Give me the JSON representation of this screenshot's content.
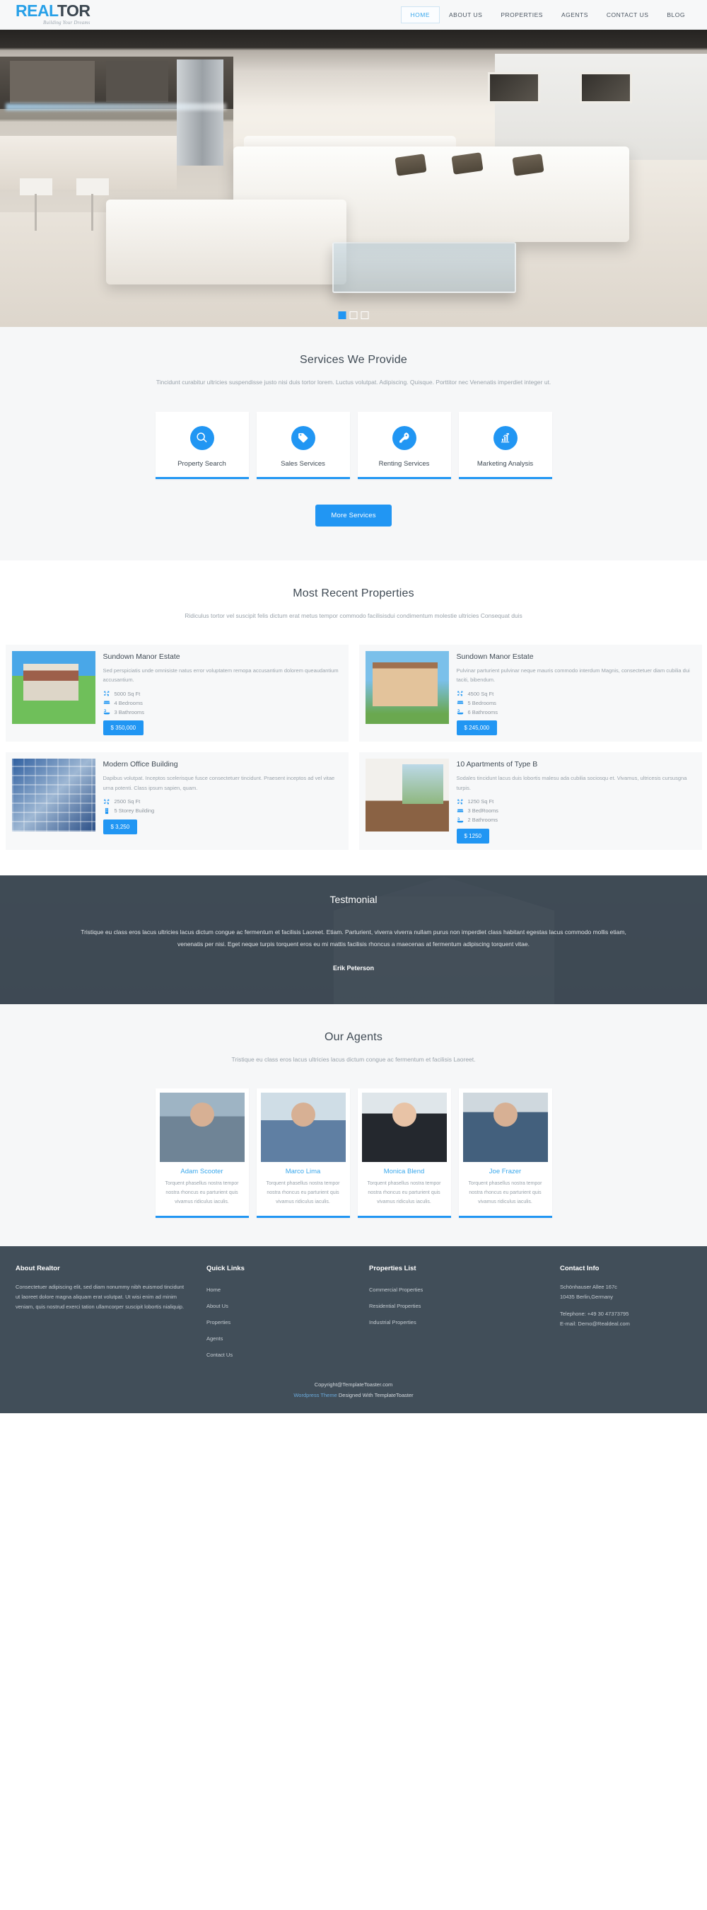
{
  "header": {
    "logo_primary": "REAL",
    "logo_secondary": "TOR",
    "logo_tagline": "Building Your Dreams",
    "nav": [
      {
        "label": "HOME",
        "active": true
      },
      {
        "label": "ABOUT US",
        "active": false
      },
      {
        "label": "PROPERTIES",
        "active": false
      },
      {
        "label": "AGENTS",
        "active": false
      },
      {
        "label": "CONTACT US",
        "active": false
      },
      {
        "label": "BLOG",
        "active": false
      }
    ]
  },
  "hero": {
    "slides": 3,
    "active_slide": 1,
    "image_alt": "Modern living room with white sectional sofa and open kitchen"
  },
  "services": {
    "title": "Services We Provide",
    "subtitle": "Tincidunt curabitur ultricies suspendisse justo nisi duis tortor lorem. Luctus volutpat. Adipiscing. Quisque. Porttitor nec Venenatis imperdiet integer ut.",
    "items": [
      {
        "label": "Property Search",
        "icon": "search-icon"
      },
      {
        "label": "Sales Services",
        "icon": "price-tag-icon"
      },
      {
        "label": "Renting Services",
        "icon": "key-icon"
      },
      {
        "label": "Marketing Analysis",
        "icon": "bar-chart-icon"
      }
    ],
    "button_label": "More Services"
  },
  "properties": {
    "title": "Most Recent Properties",
    "subtitle": "Ridiculus tortor vel suscipit felis dictum erat metus tempor commodo facilisisdui condimentum molestie ultricies Consequat duis",
    "items": [
      {
        "title": "Sundown Manor Estate",
        "desc": "Sed perspiciatis unde omnisiste natus error voluptatem remopa accusantium dolorem queaudantium accusantium.",
        "features": [
          "5000 Sq Ft",
          "4 Bedrooms",
          "3 Bathrooms"
        ],
        "feature_icons": [
          "area-icon",
          "bed-icon",
          "bath-icon"
        ],
        "price": "$ 350,000"
      },
      {
        "title": "Sundown Manor Estate",
        "desc": "Pulvinar parturient pulvinar neque mauris commodo interdum Magnis, consectetuer diam cubilia dui taciti, bibendum.",
        "features": [
          "4500 Sq Ft",
          "5 Bedrooms",
          "6 Bathrooms"
        ],
        "feature_icons": [
          "area-icon",
          "bed-icon",
          "bath-icon"
        ],
        "price": "$ 245,000"
      },
      {
        "title": "Modern Office Building",
        "desc": "Dapibus volutpat. Inceptos scelerisque fusce consectetuer tincidunt. Praesent inceptos ad vel vitae urna potenti. Class ipsum sapien, quam.",
        "features": [
          "2500 Sq Ft",
          "5 Storey Building"
        ],
        "feature_icons": [
          "area-icon",
          "building-icon"
        ],
        "price": "$ 3,250"
      },
      {
        "title": "10 Apartments of Type B",
        "desc": "Sodales tincidunt lacus duis lobortis malesu ada cubilia sociosqu et. Vivamus, ultricesis cursusgna turpis.",
        "features": [
          "1250 Sq Ft",
          "3 BedRooms",
          "2 Bathrooms"
        ],
        "feature_icons": [
          "area-icon",
          "bed-icon",
          "bath-icon"
        ],
        "price": "$ 1250"
      }
    ]
  },
  "testimonial": {
    "title": "Testmonial",
    "text": "Tristique eu class eros lacus ultricies lacus dictum congue ac fermentum et facilisis Laoreet. Etiam. Parturient, viverra viverra nullam purus non imperdiet class habitant egestas lacus commodo mollis etiam, venenatis per nisi. Eget neque turpis torquent eros eu mi mattis facilisis rhoncus a maecenas at fermentum adipiscing torquent vitae.",
    "author": "Erik Peterson"
  },
  "agents": {
    "title": "Our Agents",
    "subtitle": "Tristique eu class eros lacus ultricies lacus dictum congue ac fermentum et facilisis Laoreet.",
    "items": [
      {
        "name": "Adam Scooter",
        "desc": "Torquent phasellus nostra tempor nostra rhoncus eu parturient quis vivamus ridiculus iaculis."
      },
      {
        "name": "Marco Lima",
        "desc": "Torquent phasellus nostra tempor nostra rhoncus eu parturient quis vivamus ridiculus iaculis."
      },
      {
        "name": "Monica Blend",
        "desc": "Torquent phasellus nostra tempor nostra rhoncus eu parturient quis vivamus ridiculus iaculis."
      },
      {
        "name": "Joe Frazer",
        "desc": "Torquent phasellus nostra tempor nostra rhoncus eu parturient quis vivamus ridiculus iaculis."
      }
    ]
  },
  "footer": {
    "about": {
      "title": "About Realtor",
      "text": "Consectetuer adipiscing elit, sed diam nonummy nibh euismod tincidunt ut laoreet dolore magna aliquam erat volutpat. Ut wisi enim ad minim veniam, quis nostrud exerci tation ullamcorper suscipit lobortis nialiquip."
    },
    "quick_links": {
      "title": "Quick Links",
      "items": [
        "Home",
        "About Us",
        "Properties",
        "Agents",
        "Contact Us"
      ]
    },
    "properties_list": {
      "title": "Properties List",
      "items": [
        "Commercial Properties",
        "Residential Properties",
        "Industrial Properties"
      ]
    },
    "contact": {
      "title": "Contact Info",
      "address_line1": "Schönhauser Allee 167c",
      "address_line2": "10435 Berlin,Germany",
      "telephone": "Telephone: +49 30 47373795",
      "email": "E-mail: Demo@Realdeal.com"
    },
    "copyright": "Copyright@TemplateToaster.com",
    "credit_link": "Wordpress Theme",
    "credit_rest": " Designed With TemplateToaster"
  },
  "colors": {
    "accent": "#2196f3",
    "dark": "#414e59",
    "muted": "#9aa3ab"
  }
}
